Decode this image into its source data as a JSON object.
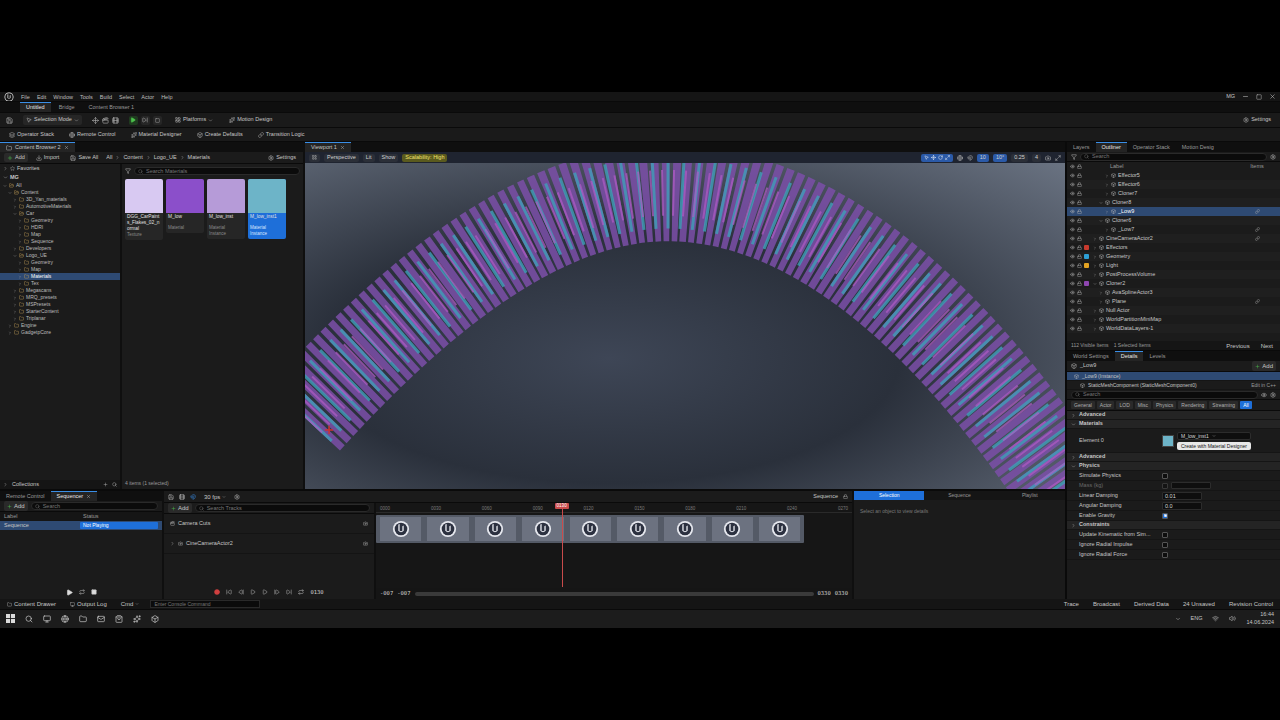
{
  "menu": [
    "File",
    "Edit",
    "Window",
    "Tools",
    "Build",
    "Select",
    "Actor",
    "Help"
  ],
  "user": "MG",
  "doc_tabs": [
    {
      "label": "Untitled",
      "selected": true
    },
    {
      "label": "Bridge",
      "selected": false
    },
    {
      "label": "Content Browser 1",
      "selected": false
    }
  ],
  "main_toolbar": {
    "selection_mode": "Selection Mode",
    "platforms": "Platforms",
    "motion_design": "Motion Design",
    "settings": "Settings"
  },
  "tool_tabs": [
    "Operator Stack",
    "Remote Control",
    "Material Designer",
    "Create Defaults",
    "Transition Logic"
  ],
  "content_browser": {
    "tab": "Content Browser 2",
    "actions": [
      "Add",
      "Import",
      "Save All"
    ],
    "path": [
      "All",
      "Content",
      "Logo_UE",
      "Materials"
    ],
    "settings": "Settings",
    "search_placeholder": "Search Materials",
    "favorites": "Favorites",
    "root": "MG",
    "tree": [
      {
        "label": "All",
        "depth": 0,
        "expanded": true,
        "selected": false
      },
      {
        "label": "Content",
        "depth": 1,
        "expanded": true,
        "selected": false
      },
      {
        "label": "3D_Yan_materials",
        "depth": 2,
        "expanded": false,
        "selected": false
      },
      {
        "label": "AutomotiveMaterials",
        "depth": 2,
        "expanded": false,
        "selected": false
      },
      {
        "label": "Car",
        "depth": 2,
        "expanded": true,
        "selected": false
      },
      {
        "label": "Geometry",
        "depth": 3,
        "expanded": false,
        "selected": false
      },
      {
        "label": "HDRI",
        "depth": 3,
        "expanded": false,
        "selected": false
      },
      {
        "label": "Map",
        "depth": 3,
        "expanded": false,
        "selected": false
      },
      {
        "label": "Sequence",
        "depth": 3,
        "expanded": false,
        "selected": false
      },
      {
        "label": "Developers",
        "depth": 2,
        "expanded": false,
        "selected": false
      },
      {
        "label": "Logo_UE",
        "depth": 2,
        "expanded": true,
        "selected": false
      },
      {
        "label": "Geometry",
        "depth": 3,
        "expanded": false,
        "selected": false
      },
      {
        "label": "Map",
        "depth": 3,
        "expanded": false,
        "selected": false
      },
      {
        "label": "Materials",
        "depth": 3,
        "expanded": false,
        "selected": true
      },
      {
        "label": "Tex",
        "depth": 3,
        "expanded": false,
        "selected": false
      },
      {
        "label": "Megascans",
        "depth": 2,
        "expanded": false,
        "selected": false
      },
      {
        "label": "MRQ_presets",
        "depth": 2,
        "expanded": false,
        "selected": false
      },
      {
        "label": "MSPresets",
        "depth": 2,
        "expanded": false,
        "selected": false
      },
      {
        "label": "StarterContent",
        "depth": 2,
        "expanded": false,
        "selected": false
      },
      {
        "label": "Triplanar",
        "depth": 2,
        "expanded": false,
        "selected": false
      },
      {
        "label": "Engine",
        "depth": 1,
        "expanded": false,
        "selected": false
      },
      {
        "label": "GadgetpCore",
        "depth": 1,
        "expanded": false,
        "selected": false
      }
    ],
    "assets": [
      {
        "name": "DGG_CarPaints_Flakes_02_normal",
        "type": "Texture",
        "color": "#d8c9f2",
        "selected": false
      },
      {
        "name": "M_low",
        "type": "Material",
        "color": "#8b4fca",
        "selected": false
      },
      {
        "name": "M_low_inst",
        "type": "Material Instance",
        "color": "#b69bd8",
        "selected": false
      },
      {
        "name": "M_low_inst1",
        "type": "Material Instance",
        "color": "#6db4c8",
        "selected": true
      }
    ],
    "collections": "Collections",
    "count": "4 items (1 selected)"
  },
  "viewport": {
    "tab": "Viewport 1",
    "buttons": [
      "Perspective",
      "Lit",
      "Show"
    ],
    "scalability": "Scalability: High",
    "snaps": [
      "10",
      "10°",
      "0.25",
      "4"
    ]
  },
  "outliner": {
    "tabs": [
      {
        "label": "Layers",
        "selected": false
      },
      {
        "label": "Outliner",
        "selected": true
      },
      {
        "label": "Operator Stack",
        "selected": false
      },
      {
        "label": "Motion Desig",
        "selected": false
      }
    ],
    "search_placeholder": "Search",
    "columns": [
      "Label",
      "Items"
    ],
    "rows": [
      {
        "label": "Effector5",
        "depth": 2,
        "expanded": false,
        "selected": false,
        "item_icon": false
      },
      {
        "label": "Effector6",
        "depth": 2,
        "expanded": false,
        "selected": false,
        "item_icon": false
      },
      {
        "label": "Cloner7",
        "depth": 2,
        "expanded": false,
        "selected": false,
        "item_icon": false
      },
      {
        "label": "Cloner8",
        "depth": 1,
        "expanded": true,
        "selected": false,
        "item_icon": false
      },
      {
        "label": "_Low9",
        "depth": 2,
        "expanded": false,
        "selected": true,
        "item_icon": true
      },
      {
        "label": "Cloner6",
        "depth": 1,
        "expanded": true,
        "selected": false,
        "item_icon": false
      },
      {
        "label": "_Low7",
        "depth": 2,
        "expanded": false,
        "selected": false,
        "item_icon": true
      },
      {
        "label": "CineCameraActor2",
        "depth": 0,
        "expanded": false,
        "selected": false,
        "item_icon": true
      },
      {
        "label": "Effectors",
        "depth": 0,
        "expanded": false,
        "selected": false,
        "item_icon": false,
        "color": "#c83a2e"
      },
      {
        "label": "Geometry",
        "depth": 0,
        "expanded": false,
        "selected": false,
        "item_icon": false,
        "color": "#2d9fd6"
      },
      {
        "label": "Light",
        "depth": 0,
        "expanded": false,
        "selected": false,
        "item_icon": false,
        "color": "#e3a322"
      },
      {
        "label": "PostProcessVolume",
        "depth": 0,
        "expanded": false,
        "selected": false,
        "item_icon": false
      },
      {
        "label": "Cloner2",
        "depth": 0,
        "expanded": true,
        "selected": false,
        "item_icon": false,
        "color": "#8e46b0"
      },
      {
        "label": "AvaSplineActor3",
        "depth": 1,
        "expanded": false,
        "selected": false,
        "item_icon": false
      },
      {
        "label": "Plane",
        "depth": 1,
        "expanded": false,
        "selected": false,
        "item_icon": true
      },
      {
        "label": "Null Actor",
        "depth": 0,
        "expanded": false,
        "selected": false,
        "item_icon": false
      },
      {
        "label": "WorldPartitionMiniMap",
        "depth": 0,
        "expanded": false,
        "selected": false,
        "item_icon": false
      },
      {
        "label": "WorldDataLayers-1",
        "depth": 0,
        "expanded": false,
        "selected": false,
        "item_icon": false
      }
    ],
    "footer": {
      "visible": "112 Visible Items",
      "selected": "1 Selected Items",
      "previous": "Previous",
      "next": "Next"
    }
  },
  "details": {
    "tabs": [
      {
        "label": "World Settings",
        "selected": false
      },
      {
        "label": "Details",
        "selected": true
      },
      {
        "label": "Levels",
        "selected": false
      }
    ],
    "actor": "_Low9",
    "add": "Add",
    "components": [
      {
        "label": "_Low9 (Instance)",
        "selected": true
      },
      {
        "label": "StaticMeshComponent (StaticMeshComponent0)",
        "selected": false
      }
    ],
    "edit_code": "Edit in C++",
    "search_placeholder": "Search",
    "filters": [
      {
        "label": "General",
        "selected": false
      },
      {
        "label": "Actor",
        "selected": false
      },
      {
        "label": "LOD",
        "selected": false
      },
      {
        "label": "Misc",
        "selected": false
      },
      {
        "label": "Physics",
        "selected": false
      },
      {
        "label": "Rendering",
        "selected": false
      },
      {
        "label": "Streaming",
        "selected": false
      },
      {
        "label": "All",
        "selected": true
      }
    ],
    "rows": [
      {
        "kind": "section",
        "label": "Advanced",
        "expanded": false
      },
      {
        "kind": "section",
        "label": "Materials",
        "expanded": true
      },
      {
        "kind": "material",
        "label": "Element 0",
        "value": "M_low_inst1",
        "color": "#6db4c8",
        "button": "Create with Material Designer"
      },
      {
        "kind": "section",
        "label": "Advanced",
        "expanded": false
      },
      {
        "kind": "section",
        "label": "Physics",
        "expanded": true
      },
      {
        "kind": "checkbox",
        "label": "Simulate Physics",
        "checked": false,
        "disabled": false
      },
      {
        "kind": "number",
        "label": "Mass (kg)",
        "value": "",
        "checked": false,
        "disabled": true
      },
      {
        "kind": "number",
        "label": "Linear Damping",
        "value": "0.01",
        "disabled": false
      },
      {
        "kind": "number",
        "label": "Angular Damping",
        "value": "0.0",
        "disabled": false
      },
      {
        "kind": "checkbox",
        "label": "Enable Gravity",
        "checked": true,
        "disabled": false
      },
      {
        "kind": "section",
        "label": "Constraints",
        "expanded": false
      },
      {
        "kind": "checkbox",
        "label": "Update Kinematic from Sim...",
        "checked": false,
        "disabled": false
      },
      {
        "kind": "checkbox",
        "label": "Ignore Radial Impulse",
        "checked": false,
        "disabled": false
      },
      {
        "kind": "checkbox",
        "label": "Ignore Radial Force",
        "checked": false,
        "disabled": false
      }
    ]
  },
  "rundown": {
    "tabs": [
      {
        "label": "Remote Control",
        "selected": false
      },
      {
        "label": "Sequencer",
        "selected": true
      }
    ],
    "add": "Add",
    "search_placeholder": "Search",
    "columns": [
      "Label",
      "Status"
    ],
    "rows": [
      {
        "label": "Sequence",
        "status": "Not Playing",
        "selected": true
      }
    ]
  },
  "sequencer": {
    "fps": "30 fps",
    "add": "Add",
    "search_placeholder": "Search Tracks",
    "sequence": "Sequence",
    "tracks": [
      "Camera Cuts",
      "CineCameraActor2"
    ],
    "time": "0130",
    "playhead": "0130",
    "level": 0.39,
    "ticks": [
      "0000",
      "0030",
      "0060",
      "0090",
      "0120",
      "0150",
      "0180",
      "0210",
      "0240",
      "0270"
    ],
    "range_start": [
      "-007",
      "-007"
    ],
    "range_end": [
      "0330",
      "0330"
    ],
    "panel_tabs": [
      {
        "label": "Selection",
        "selected": true
      },
      {
        "label": "Sequence",
        "selected": false
      },
      {
        "label": "Playlist",
        "selected": false
      }
    ],
    "panel_message": "Select an object to view details"
  },
  "status_bar": {
    "left": [
      "Content Drawer",
      "Output Log"
    ],
    "cmd": "Cmd",
    "console_placeholder": "Enter Console Command",
    "right": [
      "Trace",
      "Broadcast",
      "Derived Data",
      "24 Unsaved",
      "Revision Control"
    ]
  },
  "taskbar": {
    "language": "ENG",
    "time": "16:44",
    "date": "14.06.2024"
  }
}
